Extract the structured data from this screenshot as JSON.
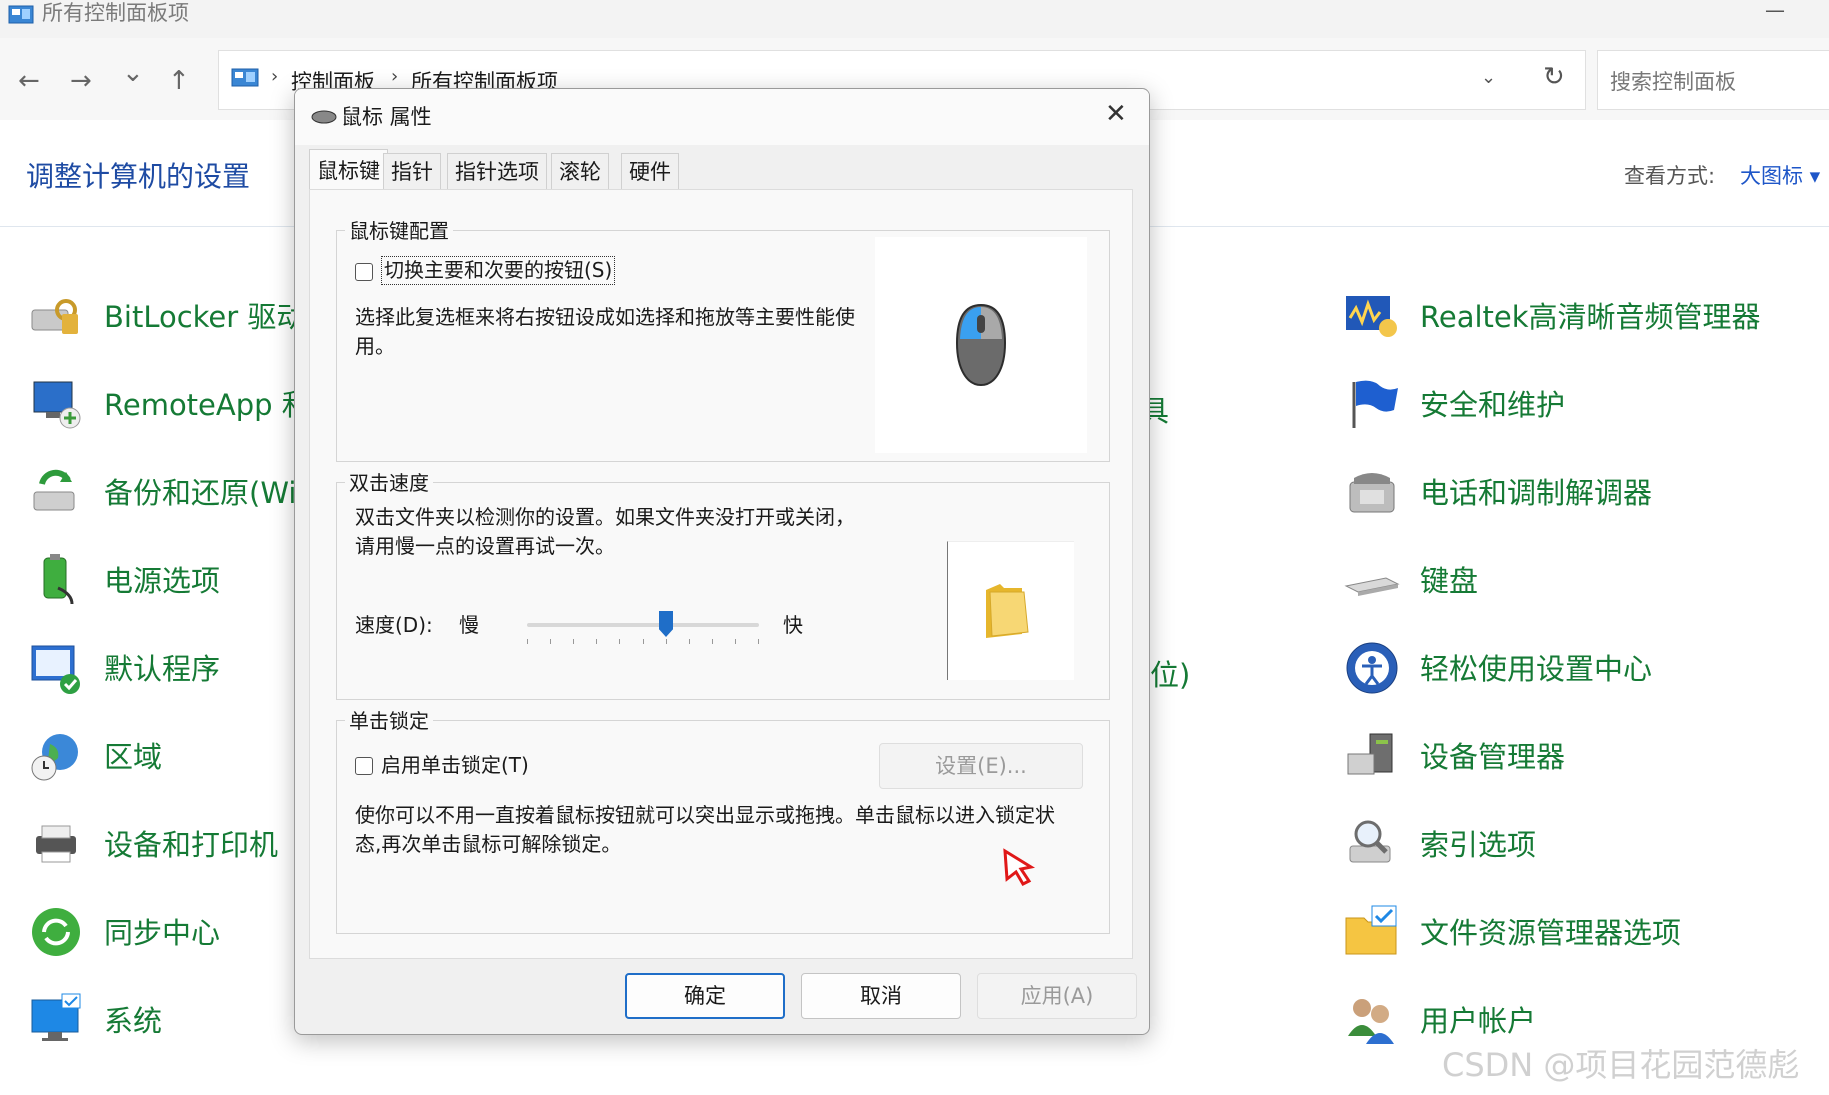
{
  "window": {
    "title": "所有控制面板项",
    "minimize_glyph": "—"
  },
  "nav": {
    "back_glyph": "←",
    "forward_glyph": "→",
    "recent_glyph": "⌄",
    "up_glyph": "↑",
    "address": {
      "icon": "control-panel-icon",
      "crumbs": [
        "控制面板",
        "所有控制面板项"
      ],
      "separator": "›",
      "dropdown_glyph": "⌄",
      "refresh_glyph": "↻"
    },
    "search": {
      "placeholder": "搜索控制面板"
    }
  },
  "header": {
    "title": "调整计算机的设置",
    "view_by_label": "查看方式:",
    "view_mode": "大图标 ▾"
  },
  "items_left": [
    {
      "label": "BitLocker 驱动",
      "icon": "bitlocker-icon"
    },
    {
      "label": "RemoteApp 和",
      "icon": "remoteapp-icon"
    },
    {
      "label": "备份和还原(Wi",
      "icon": "backup-icon"
    },
    {
      "label": "电源选项",
      "icon": "power-icon"
    },
    {
      "label": "默认程序",
      "icon": "default-programs-icon"
    },
    {
      "label": "区域",
      "icon": "region-icon"
    },
    {
      "label": "设备和打印机",
      "icon": "printer-icon"
    },
    {
      "label": "同步中心",
      "icon": "sync-icon"
    },
    {
      "label": "系统",
      "icon": "system-icon"
    }
  ],
  "items_right": [
    {
      "label": "Realtek高清晰音频管理器",
      "icon": "realtek-audio-icon"
    },
    {
      "label": "安全和维护",
      "icon": "security-flag-icon"
    },
    {
      "label": "电话和调制解调器",
      "icon": "phone-modem-icon"
    },
    {
      "label": "键盘",
      "icon": "keyboard-icon"
    },
    {
      "label": "轻松使用设置中心",
      "icon": "ease-of-access-icon"
    },
    {
      "label": "设备管理器",
      "icon": "device-manager-icon"
    },
    {
      "label": "索引选项",
      "icon": "indexing-icon"
    },
    {
      "label": "文件资源管理器选项",
      "icon": "folder-options-icon"
    },
    {
      "label": "用户帐户",
      "icon": "user-accounts-icon"
    }
  ],
  "fragments": {
    "mid1": "具",
    "mid2": "位)"
  },
  "dialog": {
    "title": "鼠标 属性",
    "close_glyph": "✕",
    "tabs": [
      "鼠标键",
      "指针",
      "指针选项",
      "滚轮",
      "硬件"
    ],
    "button_config": {
      "legend": "鼠标键配置",
      "checkbox_label": "切换主要和次要的按钮(S)",
      "description": "选择此复选框来将右按钮设成如选择和拖放等主要性能使用。"
    },
    "double_click": {
      "legend": "双击速度",
      "description": "双击文件夹以检测你的设置。如果文件夹没打开或关闭，请用慢一点的设置再试一次。",
      "speed_label": "速度(D):",
      "slow": "慢",
      "fast": "快",
      "speed_fraction": 0.6
    },
    "click_lock": {
      "legend": "单击锁定",
      "checkbox_label": "启用单击锁定(T)",
      "settings_button": "设置(E)...",
      "description": "使你可以不用一直按着鼠标按钮就可以突出显示或拖拽。单击鼠标以进入锁定状态,再次单击鼠标可解除锁定。"
    },
    "buttons": {
      "ok": "确定",
      "cancel": "取消",
      "apply": "应用(A)"
    }
  },
  "watermark": "CSDN @项目花园范德彪",
  "colors": {
    "link_green": "#157a35",
    "title_blue": "#1e4ba3",
    "accent": "#1f6ec8"
  }
}
